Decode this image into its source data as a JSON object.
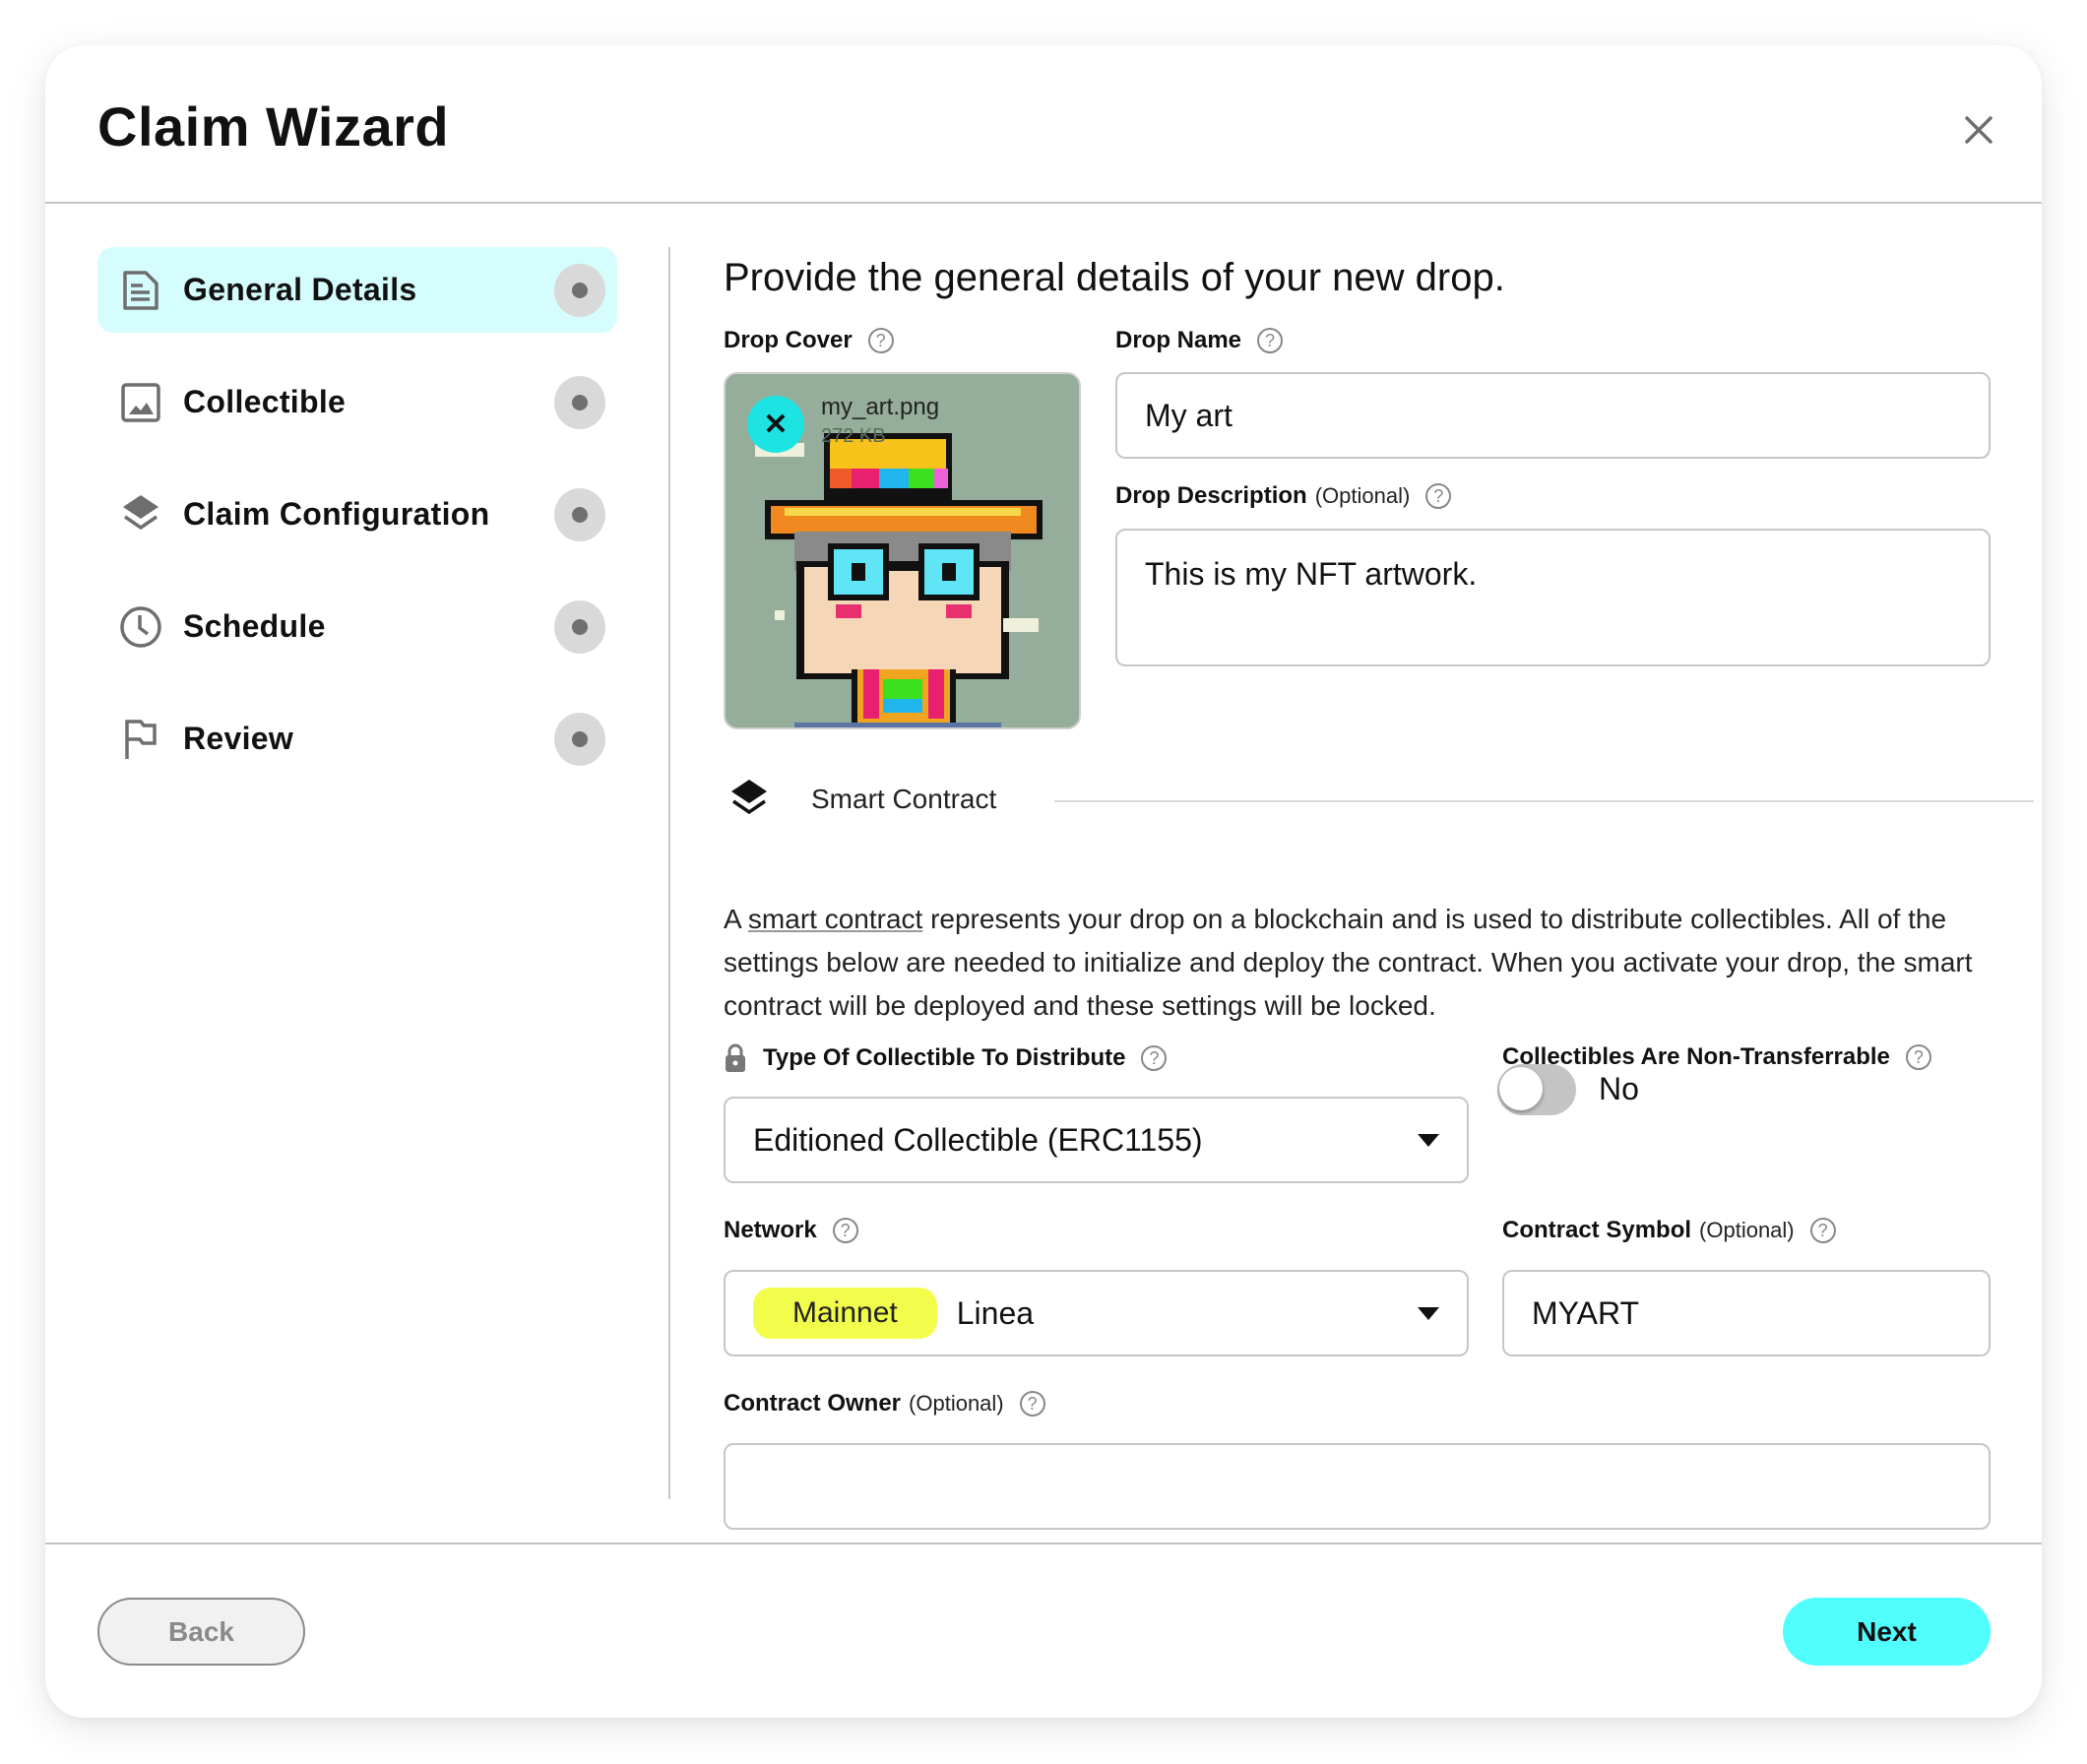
{
  "dialog": {
    "title": "Claim Wizard",
    "close_icon": "close-icon"
  },
  "sidebar": {
    "items": [
      {
        "label": "General Details",
        "icon": "document-icon",
        "active": true
      },
      {
        "label": "Collectible",
        "icon": "image-icon",
        "active": false
      },
      {
        "label": "Claim Configuration",
        "icon": "layers-icon",
        "active": false
      },
      {
        "label": "Schedule",
        "icon": "clock-icon",
        "active": false
      },
      {
        "label": "Review",
        "icon": "flag-icon",
        "active": false
      }
    ]
  },
  "main": {
    "heading": "Provide the general details of your new drop.",
    "drop_cover": {
      "label": "Drop Cover",
      "file_name": "my_art.png",
      "file_size": "272 KB",
      "remove_symbol": "✕"
    },
    "drop_name": {
      "label": "Drop Name",
      "value": "My art"
    },
    "drop_description": {
      "label": "Drop Description",
      "optional": "(Optional)",
      "value": "This is my NFT artwork."
    },
    "smart_contract": {
      "section_title": "Smart Contract",
      "para_prefix": "A ",
      "para_link": "smart contract",
      "para_rest": " represents your drop on a blockchain and is used to distribute collectibles. All of the settings below are needed to initialize and deploy the contract. When you activate your drop, the smart contract will be deployed and these settings will be locked."
    },
    "collectible_type": {
      "label": "Type Of Collectible To Distribute",
      "value": "Editioned Collectible (ERC1155)",
      "locked": true
    },
    "non_transferrable": {
      "label": "Collectibles Are Non-Transferrable",
      "value": "No",
      "enabled": false
    },
    "network": {
      "label": "Network",
      "badge": "Mainnet",
      "value": "Linea",
      "badge_color": "#f2fd4b"
    },
    "contract_symbol": {
      "label": "Contract Symbol",
      "optional": "(Optional)",
      "value": "MYART"
    },
    "contract_owner": {
      "label": "Contract Owner",
      "optional": "(Optional)",
      "value": ""
    },
    "help_symbol": "?"
  },
  "footer": {
    "back_label": "Back",
    "next_label": "Next"
  },
  "colors": {
    "accent": "#50fefe",
    "active_step_bg": "#d5fdfd",
    "remove_button": "#1de3e3"
  }
}
